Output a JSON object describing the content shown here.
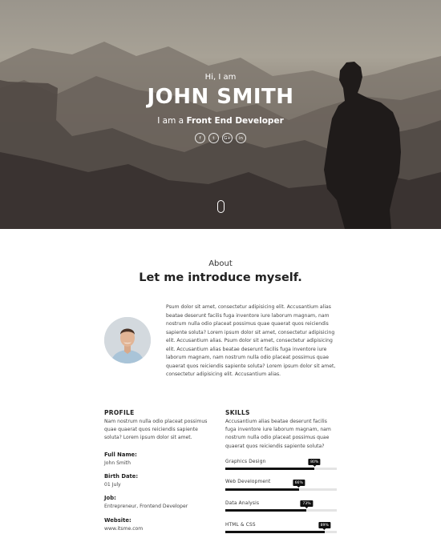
{
  "hero": {
    "greeting": "Hi, I am",
    "name": "JOHN SMITH",
    "role_prefix": "I am a",
    "role": "Front End Developer",
    "socials": [
      {
        "icon": "facebook-icon",
        "glyph": "f"
      },
      {
        "icon": "twitter-icon",
        "glyph": "t"
      },
      {
        "icon": "google-plus-icon",
        "glyph": "G+"
      },
      {
        "icon": "linkedin-icon",
        "glyph": "in"
      }
    ],
    "scroll_icon": "mouse-scroll-icon"
  },
  "about": {
    "label": "About",
    "title": "Let me introduce myself.",
    "text": "Psum dolor sit amet, consectetur adipisicing elit. Accusantium alias beatae deserunt facilis fuga inventore iure laborum magnam, nam nostrum nulla odio placeat possimus quae quaerat quos reiciendis sapiente soluta? Lorem ipsum dolor sit amet, consectetur adipisicing elit. Accusantium alias. Psum dolor sit amet, consectetur adipisicing elit. Accusantium alias beatae deserunt facilis fuga inventore iure laborum magnam, nam nostrum nulla odio placeat possimus quae quaerat quos reiciendis sapiente soluta? Lorem ipsum dolor sit amet, consectetur adipisicing elit. Accusantium alias."
  },
  "profile": {
    "heading": "PROFILE",
    "text": "Nam nostrum nulla odio placeat possimus quae quaerat quos reiciendis sapiente soluta? Lorem ipsum dolor sit amet.",
    "fields": [
      {
        "label": "Full Name:",
        "value": "John Smith"
      },
      {
        "label": "Birth Date:",
        "value": "01 July"
      },
      {
        "label": "Job:",
        "value": "Entrepreneur, Frontend Developer"
      },
      {
        "label": "Website:",
        "value": "www.itsme.com"
      }
    ]
  },
  "skills": {
    "heading": "SKILLS",
    "text": "Accusantium alias beatae deserunt facilis fuga inventore iure laborum magnam, nam nostrum nulla odio placeat possimus quae quaerat quos reiciendis sapiente soluta?",
    "items": [
      {
        "name": "Graphics Design",
        "label": "80%",
        "percent": 80
      },
      {
        "name": "Web Development",
        "label": "66%",
        "percent": 66
      },
      {
        "name": "Data Analysis",
        "label": "73%",
        "percent": 73
      },
      {
        "name": "HTML & CSS",
        "label": "89%",
        "percent": 89
      }
    ]
  },
  "colors": {
    "accent": "#111111",
    "track": "#e4e4e4"
  }
}
